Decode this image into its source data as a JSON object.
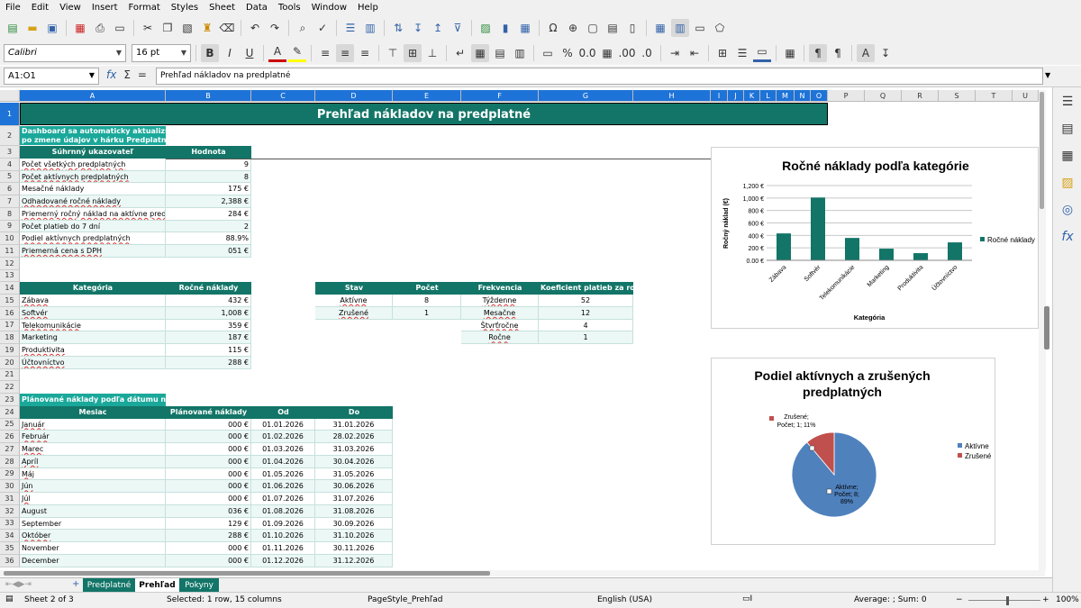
{
  "menu": [
    "File",
    "Edit",
    "View",
    "Insert",
    "Format",
    "Styles",
    "Sheet",
    "Data",
    "Tools",
    "Window",
    "Help"
  ],
  "toolbar": {
    "font_name": "Calibri",
    "font_size": "16 pt"
  },
  "formula": {
    "cell_ref": "A1:O1",
    "content": "Prehľad nákladov na predplatné"
  },
  "columns": [
    "A",
    "B",
    "C",
    "D",
    "E",
    "F",
    "G",
    "H",
    "I",
    "J",
    "K",
    "L",
    "M",
    "N",
    "O",
    "P",
    "Q",
    "R",
    "S",
    "T",
    "U"
  ],
  "rows": [
    "1",
    "2",
    "3",
    "4",
    "5",
    "6",
    "7",
    "8",
    "9",
    "10",
    "11",
    "12",
    "13",
    "14",
    "15",
    "16",
    "17",
    "18",
    "19",
    "20",
    "21",
    "22",
    "23",
    "24",
    "25",
    "26",
    "27",
    "28",
    "29",
    "30",
    "31",
    "32",
    "33",
    "34",
    "35",
    "36"
  ],
  "sheet": {
    "title": "Prehľad nákladov na predplatné",
    "subtitle_line1": "Dashboard sa automaticky aktualizuje",
    "subtitle_line2": "po zmene údajov v hárku Predplatné",
    "summary_header": [
      "Súhrnný ukazovateľ",
      "Hodnota"
    ],
    "summary": [
      {
        "label": "Počet všetkých predplatných",
        "value": "9"
      },
      {
        "label": "Počet aktívnych predplatných",
        "value": "8"
      },
      {
        "label": "Mesačné náklady",
        "value": "175 €"
      },
      {
        "label": "Odhadované ročné náklady",
        "value": "2,388 €"
      },
      {
        "label": "Priemerný ročný náklad na aktívne predplatn",
        "value": "284 €"
      },
      {
        "label": "Počet platieb do 7 dní",
        "value": "2"
      },
      {
        "label": "Podiel aktívnych predplatných",
        "value": "88.9%"
      },
      {
        "label": "Priemerná cena s DPH",
        "value": "051 €"
      }
    ],
    "category_header": [
      "Kategória",
      "Ročné náklady"
    ],
    "categories": [
      {
        "name": "Zábava",
        "value": "432 €"
      },
      {
        "name": "Softvér",
        "value": "1,008 €"
      },
      {
        "name": "Telekomunikácie",
        "value": "359 €"
      },
      {
        "name": "Marketing",
        "value": "187 €"
      },
      {
        "name": "Produktivita",
        "value": "115 €"
      },
      {
        "name": "Účtovníctvo",
        "value": "288 €"
      }
    ],
    "status_header": [
      "Stav",
      "Počet"
    ],
    "statuses": [
      {
        "name": "Aktívne",
        "count": "8"
      },
      {
        "name": "Zrušené",
        "count": "1"
      }
    ],
    "freq_header": [
      "Frekvencia",
      "Koeficient platieb za rok"
    ],
    "frequencies": [
      {
        "name": "Týždenne",
        "coef": "52"
      },
      {
        "name": "Mesačne",
        "coef": "12"
      },
      {
        "name": "Štvrťročne",
        "coef": "4"
      },
      {
        "name": "Ročne",
        "coef": "1"
      }
    ],
    "planned_title": "Plánované náklady podľa dátumu na",
    "planned_header": [
      "Mesiac",
      "Plánované náklady",
      "Od",
      "Do"
    ],
    "planned": [
      {
        "m": "Január",
        "v": "000 €",
        "od": "01.01.2026",
        "do": "31.01.2026"
      },
      {
        "m": "Február",
        "v": "000 €",
        "od": "01.02.2026",
        "do": "28.02.2026"
      },
      {
        "m": "Marec",
        "v": "000 €",
        "od": "01.03.2026",
        "do": "31.03.2026"
      },
      {
        "m": "Apríl",
        "v": "000 €",
        "od": "01.04.2026",
        "do": "30.04.2026"
      },
      {
        "m": "Máj",
        "v": "000 €",
        "od": "01.05.2026",
        "do": "31.05.2026"
      },
      {
        "m": "Jún",
        "v": "000 €",
        "od": "01.06.2026",
        "do": "30.06.2026"
      },
      {
        "m": "Júl",
        "v": "000 €",
        "od": "01.07.2026",
        "do": "31.07.2026"
      },
      {
        "m": "August",
        "v": "036 €",
        "od": "01.08.2026",
        "do": "31.08.2026"
      },
      {
        "m": "September",
        "v": "129 €",
        "od": "01.09.2026",
        "do": "30.09.2026"
      },
      {
        "m": "Október",
        "v": "288 €",
        "od": "01.10.2026",
        "do": "31.10.2026"
      },
      {
        "m": "November",
        "v": "000 €",
        "od": "01.11.2026",
        "do": "30.11.2026"
      },
      {
        "m": "December",
        "v": "000 €",
        "od": "01.12.2026",
        "do": "31.12.2026"
      }
    ]
  },
  "chart_data": [
    {
      "type": "bar",
      "title": "Ročné náklady podľa kategórie",
      "xlabel": "Kategória",
      "ylabel": "Ročný náklad (€)",
      "categories": [
        "Zábava",
        "Softvér",
        "Telekomunikácie",
        "Marketing",
        "Produktivita",
        "Účtovníctvo"
      ],
      "series": [
        {
          "name": "Ročné náklady",
          "values": [
            432,
            1008,
            359,
            187,
            115,
            288
          ]
        }
      ],
      "yticks": [
        "0.00 €",
        "200 €",
        "400 €",
        "600 €",
        "800 €",
        "1,000 €",
        "1,200 €"
      ],
      "ylim": [
        0,
        1200
      ],
      "grid": true,
      "legend": "right",
      "color": "#127567"
    },
    {
      "type": "pie",
      "title": "Podiel aktívnych a zrušených predplatných",
      "title_line1": "Podiel aktívnych a zrušených",
      "title_line2": "predplatných",
      "categories": [
        "Aktívne",
        "Zrušené"
      ],
      "values": [
        8,
        1
      ],
      "labels": [
        [
          "Aktívne;",
          "Počet; 8;",
          "89%"
        ],
        [
          "Zrušené;",
          "Počet; 1; 11%"
        ]
      ],
      "colors": [
        "#4f81bd",
        "#c0504d"
      ],
      "legend": "right"
    }
  ],
  "tabs": [
    "Predplatné",
    "Prehľad",
    "Pokyny"
  ],
  "status": {
    "sheet": "Sheet 2 of 3",
    "selection": "Selected: 1 row, 15 columns",
    "pagestyle": "PageStyle_Prehľad",
    "language": "English (USA)",
    "sum": "Average: ; Sum: 0",
    "zoom": "100%"
  }
}
